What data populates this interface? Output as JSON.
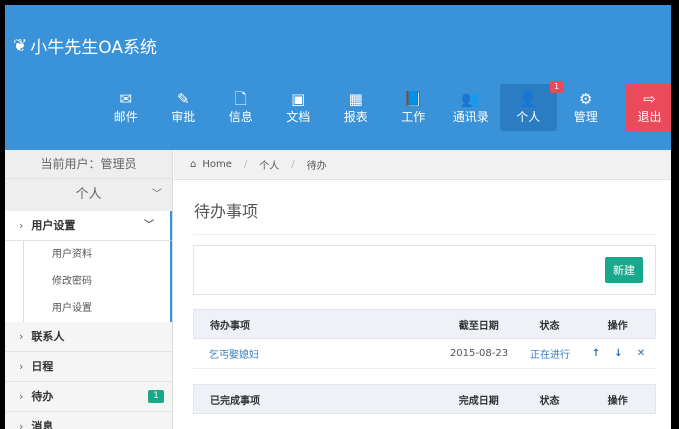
{
  "app": {
    "title": "小牛先生OA系统",
    "logo_icon": "leaf-icon"
  },
  "nav": [
    {
      "label": "邮件",
      "icon": "✉"
    },
    {
      "label": "审批",
      "icon": "✎"
    },
    {
      "label": "信息",
      "icon": "🗋"
    },
    {
      "label": "文档",
      "icon": "▣"
    },
    {
      "label": "报表",
      "icon": "▦"
    },
    {
      "label": "工作",
      "icon": "📘"
    },
    {
      "label": "通讯录",
      "icon": "👥"
    },
    {
      "label": "个人",
      "icon": "👤",
      "badge": "1"
    },
    {
      "label": "管理",
      "icon": "⚙"
    }
  ],
  "logout": {
    "label": "退出",
    "icon": "⇨"
  },
  "sidebar": {
    "current_user": "当前用户：管理员",
    "group": "个人",
    "items": [
      {
        "label": "用户设置"
      },
      {
        "label": "联系人"
      },
      {
        "label": "日程"
      },
      {
        "label": "待办",
        "badge": "1"
      },
      {
        "label": "消息"
      }
    ],
    "sub": [
      "用户资料",
      "修改密码",
      "用户设置"
    ]
  },
  "breadcrumb": [
    "Home",
    "个人",
    "待办"
  ],
  "page": {
    "title": "待办事项",
    "new_button": "新建"
  },
  "todo_table": {
    "headers": [
      "待办事项",
      "截至日期",
      "状态",
      "操作"
    ],
    "rows": [
      {
        "name": "乞丐娶媳妇",
        "date": "2015-08-23",
        "status": "正在进行"
      }
    ]
  },
  "done_table": {
    "headers": [
      "已完成事项",
      "完成日期",
      "状态",
      "操作"
    ]
  }
}
